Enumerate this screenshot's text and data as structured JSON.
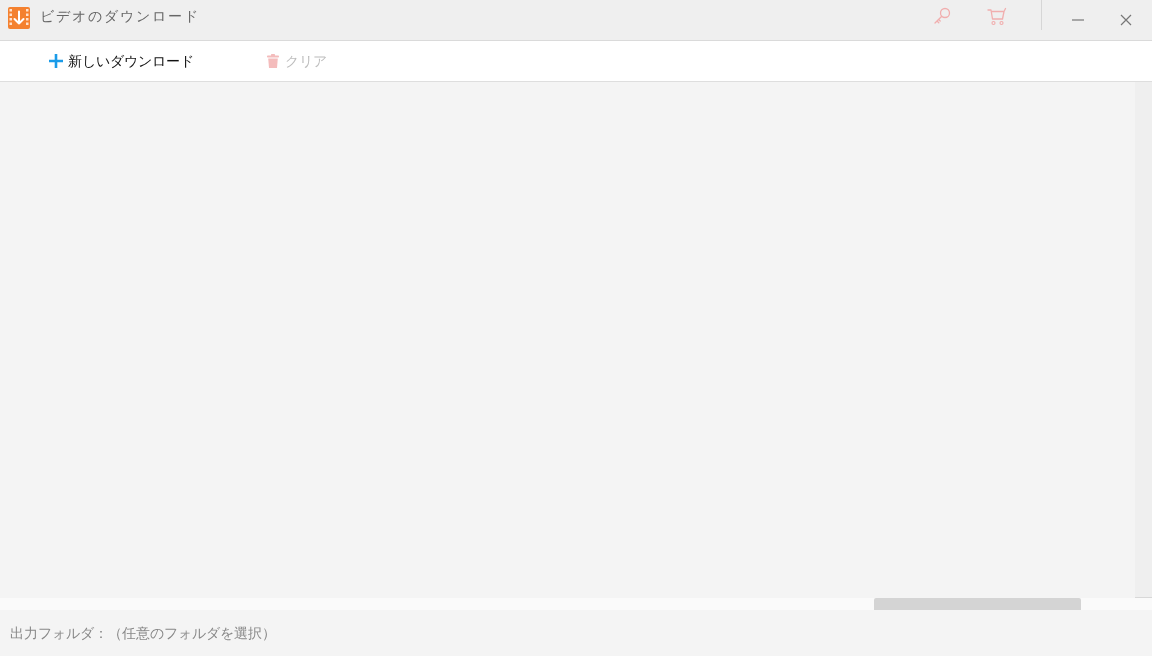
{
  "window": {
    "title": "ビデオのダウンロード"
  },
  "toolbar": [
    {
      "kind": "add",
      "label": "新しいダウンロード",
      "disabled": false
    },
    {
      "kind": "clear",
      "label": "クリア",
      "disabled": true
    }
  ],
  "status_bar": {
    "output_folder": "出力フォルダ：（任意のフォルダを選択）"
  }
}
